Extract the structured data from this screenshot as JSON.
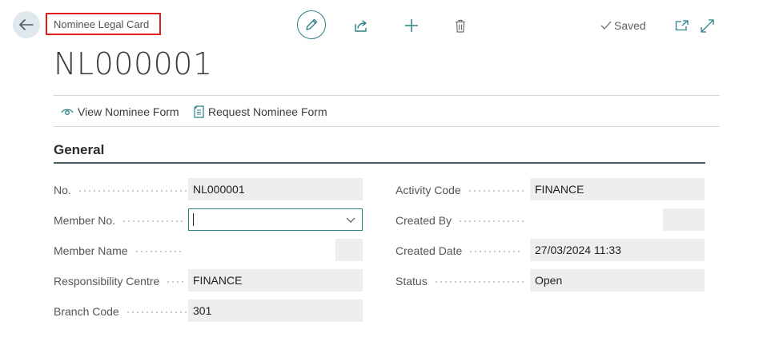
{
  "header": {
    "caption": "Nominee Legal Card",
    "status": "Saved",
    "record_title": "NL000001"
  },
  "icons": {
    "back": "back-arrow-icon",
    "edit": "pencil-icon",
    "share": "share-icon",
    "new": "plus-icon",
    "delete": "trash-icon",
    "saved": "checkmark-icon",
    "popout": "open-in-new-window-icon",
    "expand": "expand-icon"
  },
  "actions": [
    {
      "label": "View Nominee Form",
      "icon": "eye-icon"
    },
    {
      "label": "Request Nominee Form",
      "icon": "document-icon"
    }
  ],
  "section": {
    "title": "General"
  },
  "fields_left": [
    {
      "label": "No.",
      "value": "NL000001"
    },
    {
      "label": "Member No.",
      "value": ""
    },
    {
      "label": "Member Name",
      "value": ""
    },
    {
      "label": "Responsibility Centre",
      "value": "FINANCE"
    },
    {
      "label": "Branch Code",
      "value": "301"
    }
  ],
  "fields_right": [
    {
      "label": "Activity Code",
      "value": "FINANCE"
    },
    {
      "label": "Created By",
      "value": ""
    },
    {
      "label": "Created Date",
      "value": "27/03/2024 11:33"
    },
    {
      "label": "Status",
      "value": "Open"
    }
  ],
  "colors": {
    "accent": "#2a7f86",
    "highlight_border": "#e01e1e",
    "field_background": "#eeeeee"
  }
}
